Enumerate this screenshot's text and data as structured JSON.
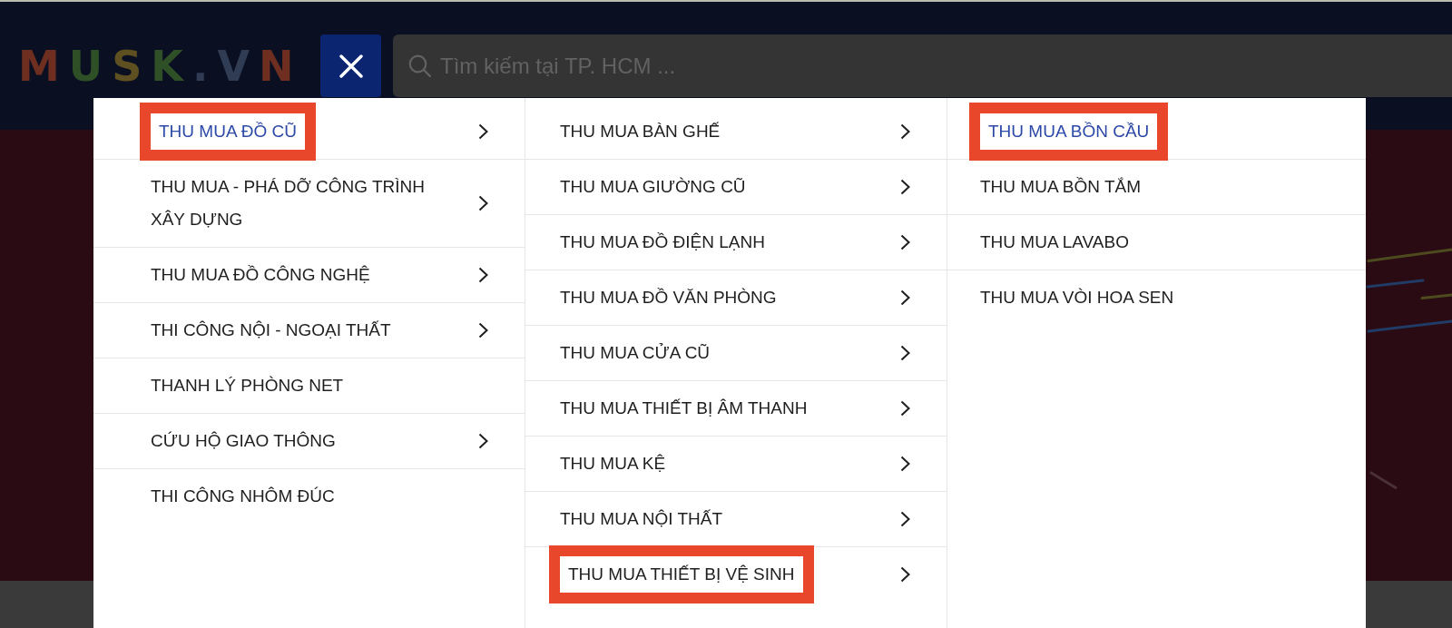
{
  "header": {
    "logo": "MUSK.VN",
    "search": {
      "placeholder": "Tìm kiếm tại TP. HCM ..."
    }
  },
  "menu": {
    "columns": [
      {
        "items": [
          {
            "label": "THU MUA ĐỒ CŨ",
            "has_submenu": true,
            "selected": true,
            "highlighted": true
          },
          {
            "label": "THU MUA - PHÁ DỠ CÔNG TRÌNH XÂY DỰNG",
            "has_submenu": true,
            "selected": false,
            "highlighted": false
          },
          {
            "label": "THU MUA ĐỒ CÔNG NGHỆ",
            "has_submenu": true,
            "selected": false,
            "highlighted": false
          },
          {
            "label": "THI CÔNG NỘI - NGOẠI THẤT",
            "has_submenu": true,
            "selected": false,
            "highlighted": false
          },
          {
            "label": "THANH LÝ PHÒNG NET",
            "has_submenu": false,
            "selected": false,
            "highlighted": false
          },
          {
            "label": "CỨU HỘ GIAO THÔNG",
            "has_submenu": true,
            "selected": false,
            "highlighted": false
          },
          {
            "label": "THI CÔNG NHÔM ĐÚC",
            "has_submenu": false,
            "selected": false,
            "highlighted": false
          }
        ]
      },
      {
        "items": [
          {
            "label": "THU MUA BÀN GHẾ",
            "has_submenu": true,
            "selected": false,
            "highlighted": false
          },
          {
            "label": "THU MUA GIƯỜNG CŨ",
            "has_submenu": true,
            "selected": false,
            "highlighted": false
          },
          {
            "label": "THU MUA ĐỒ ĐIỆN LẠNH",
            "has_submenu": true,
            "selected": false,
            "highlighted": false
          },
          {
            "label": "THU MUA ĐỒ VĂN PHÒNG",
            "has_submenu": true,
            "selected": false,
            "highlighted": false
          },
          {
            "label": "THU MUA CỬA CŨ",
            "has_submenu": true,
            "selected": false,
            "highlighted": false
          },
          {
            "label": "THU MUA THIẾT BỊ ÂM THANH",
            "has_submenu": true,
            "selected": false,
            "highlighted": false
          },
          {
            "label": "THU MUA KỆ",
            "has_submenu": true,
            "selected": false,
            "highlighted": false
          },
          {
            "label": "THU MUA NỘI THẤT",
            "has_submenu": true,
            "selected": false,
            "highlighted": false
          },
          {
            "label": "THU MUA THIẾT BỊ VỆ SINH",
            "has_submenu": true,
            "selected": false,
            "highlighted": true
          }
        ]
      },
      {
        "items": [
          {
            "label": "THU MUA BỒN CẦU",
            "has_submenu": false,
            "selected": true,
            "highlighted": true
          },
          {
            "label": "THU MUA BỒN TẮM",
            "has_submenu": false,
            "selected": false,
            "highlighted": false
          },
          {
            "label": "THU MUA LAVABO",
            "has_submenu": false,
            "selected": false,
            "highlighted": false
          },
          {
            "label": "THU MUA VÒI HOA SEN",
            "has_submenu": false,
            "selected": false,
            "highlighted": false
          }
        ]
      }
    ]
  }
}
